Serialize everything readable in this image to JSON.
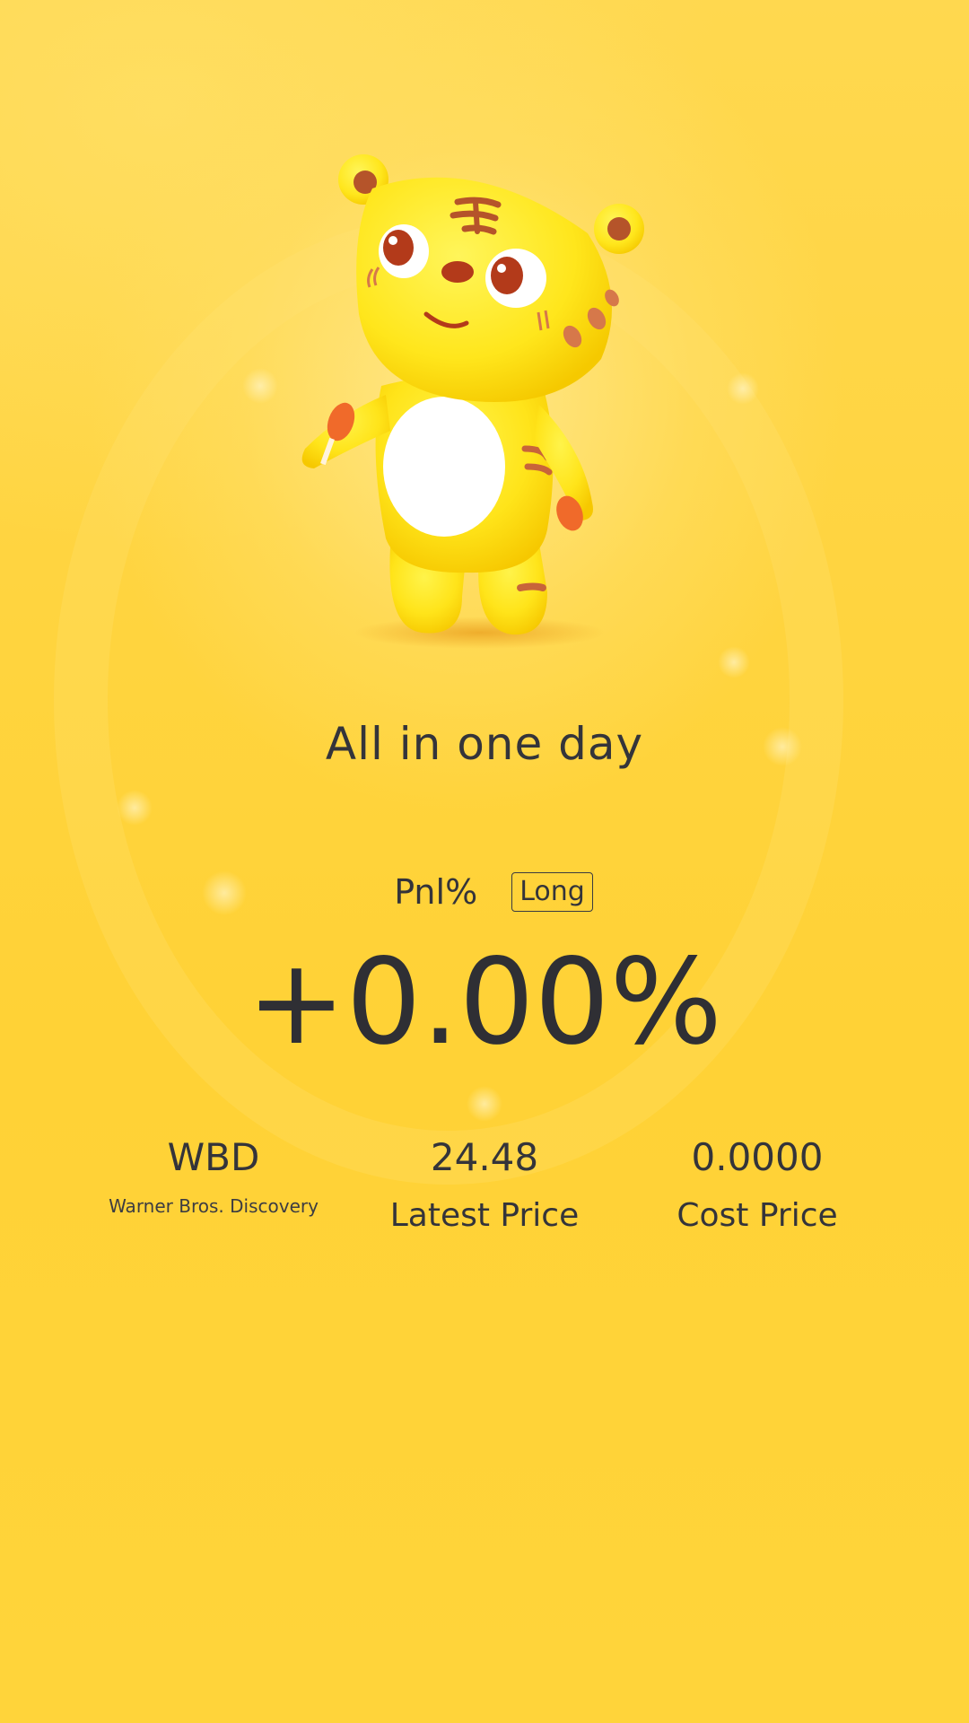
{
  "headline": "All in one day",
  "pnl": {
    "label": "Pnl%",
    "direction": "Long",
    "value": "+0.00%"
  },
  "stock": {
    "ticker": "WBD",
    "name": "Warner Bros. Discovery"
  },
  "latest_price": {
    "value": "24.48",
    "label": "Latest Price"
  },
  "cost_price": {
    "value": "0.0000",
    "label": "Cost Price"
  },
  "colors": {
    "background": "#ffd43f",
    "text": "#2f2f34",
    "mascot_body": "#ffe11a",
    "mascot_belly": "#ffffff",
    "mascot_stripes": "#c8643a"
  },
  "mascot_icon": "tiger-mascot-icon"
}
